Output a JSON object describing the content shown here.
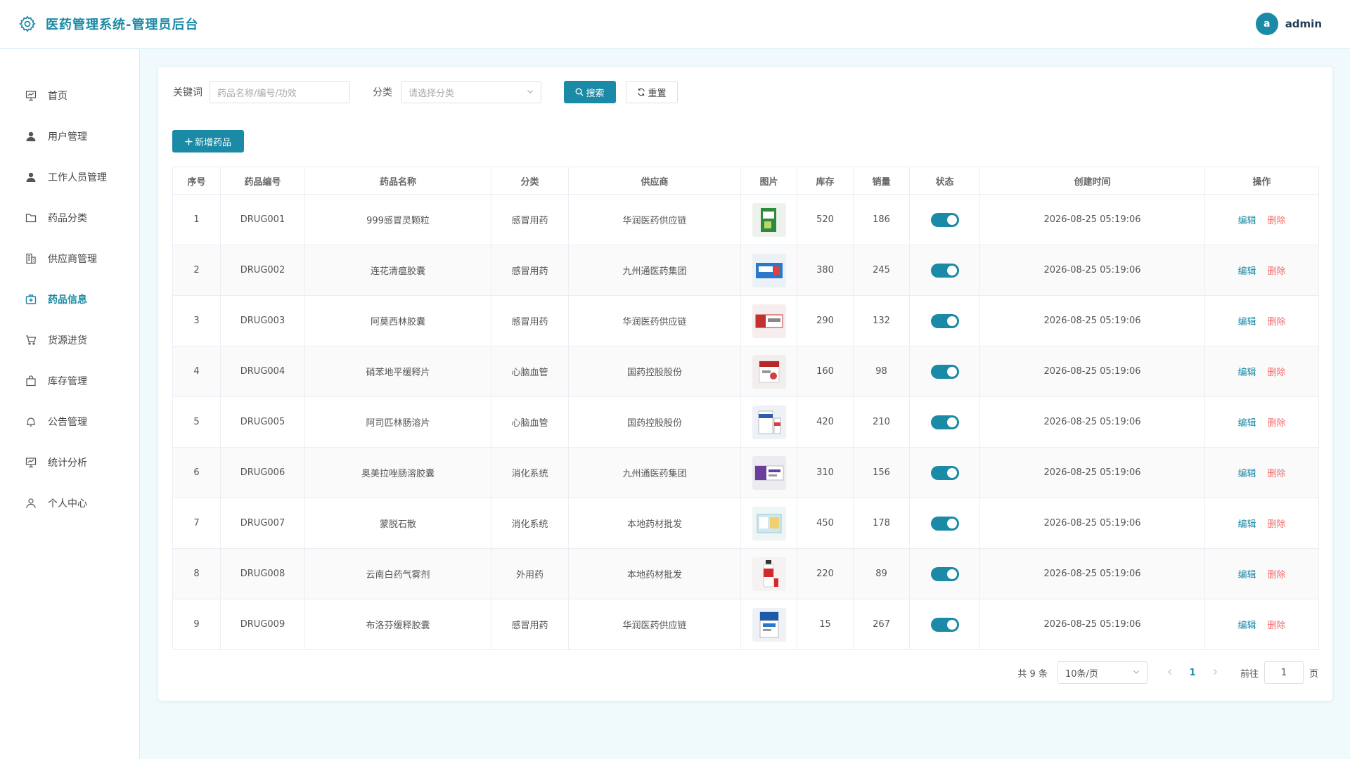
{
  "header": {
    "title": "医药管理系统-管理员后台",
    "avatar_letter": "a",
    "username": "admin"
  },
  "sidebar": {
    "items": [
      {
        "label": "首页",
        "icon": "presentation-icon"
      },
      {
        "label": "用户管理",
        "icon": "user-icon"
      },
      {
        "label": "工作人员管理",
        "icon": "user-icon"
      },
      {
        "label": "药品分类",
        "icon": "folder-icon"
      },
      {
        "label": "供应商管理",
        "icon": "building-icon"
      },
      {
        "label": "药品信息",
        "icon": "first-aid-kit-icon",
        "active": true
      },
      {
        "label": "货源进货",
        "icon": "shopping-cart-icon"
      },
      {
        "label": "库存管理",
        "icon": "shopping-bag-icon"
      },
      {
        "label": "公告管理",
        "icon": "bell-icon"
      },
      {
        "label": "统计分析",
        "icon": "presentation-icon"
      },
      {
        "label": "个人中心",
        "icon": "user-outline-icon"
      }
    ]
  },
  "filters": {
    "keyword_label": "关键词",
    "keyword_placeholder": "药品名称/编号/功效",
    "category_label": "分类",
    "category_placeholder": "请选择分类",
    "search_label": "搜索",
    "reset_label": "重置"
  },
  "add_button_label": "新增药品",
  "table": {
    "headers": [
      "序号",
      "药品编号",
      "药品名称",
      "分类",
      "供应商",
      "图片",
      "库存",
      "销量",
      "状态",
      "创建时间",
      "操作"
    ],
    "edit_label": "编辑",
    "delete_label": "删除",
    "rows": [
      {
        "index": "1",
        "code": "DRUG001",
        "name": "999感冒灵颗粒",
        "category": "感冒用药",
        "supplier": "华润医药供应链",
        "stock": "520",
        "sales": "186",
        "status": true,
        "created": "2026-08-25 05:19:06"
      },
      {
        "index": "2",
        "code": "DRUG002",
        "name": "连花清瘟胶囊",
        "category": "感冒用药",
        "supplier": "九州通医药集团",
        "stock": "380",
        "sales": "245",
        "status": true,
        "created": "2026-08-25 05:19:06"
      },
      {
        "index": "3",
        "code": "DRUG003",
        "name": "阿莫西林胶囊",
        "category": "感冒用药",
        "supplier": "华润医药供应链",
        "stock": "290",
        "sales": "132",
        "status": true,
        "created": "2026-08-25 05:19:06"
      },
      {
        "index": "4",
        "code": "DRUG004",
        "name": "硝苯地平缓释片",
        "category": "心脑血管",
        "supplier": "国药控股股份",
        "stock": "160",
        "sales": "98",
        "status": true,
        "created": "2026-08-25 05:19:06"
      },
      {
        "index": "5",
        "code": "DRUG005",
        "name": "阿司匹林肠溶片",
        "category": "心脑血管",
        "supplier": "国药控股股份",
        "stock": "420",
        "sales": "210",
        "status": true,
        "created": "2026-08-25 05:19:06"
      },
      {
        "index": "6",
        "code": "DRUG006",
        "name": "奥美拉唑肠溶胶囊",
        "category": "消化系统",
        "supplier": "九州通医药集团",
        "stock": "310",
        "sales": "156",
        "status": true,
        "created": "2026-08-25 05:19:06"
      },
      {
        "index": "7",
        "code": "DRUG007",
        "name": "蒙脱石散",
        "category": "消化系统",
        "supplier": "本地药材批发",
        "stock": "450",
        "sales": "178",
        "status": true,
        "created": "2026-08-25 05:19:06"
      },
      {
        "index": "8",
        "code": "DRUG008",
        "name": "云南白药气雾剂",
        "category": "外用药",
        "supplier": "本地药材批发",
        "stock": "220",
        "sales": "89",
        "status": true,
        "created": "2026-08-25 05:19:06"
      },
      {
        "index": "9",
        "code": "DRUG009",
        "name": "布洛芬缓释胶囊",
        "category": "感冒用药",
        "supplier": "华润医药供应链",
        "stock": "15",
        "sales": "267",
        "status": true,
        "created": "2026-08-25 05:19:06"
      }
    ]
  },
  "pagination": {
    "total_text": "共 9 条",
    "page_size": "10条/页",
    "current_page": "1",
    "goto_label": "前往",
    "goto_value": "1",
    "page_suffix": "页"
  },
  "colors": {
    "primary": "#1a8aa6",
    "danger": "#f56c6c",
    "background": "#f0fafc"
  }
}
